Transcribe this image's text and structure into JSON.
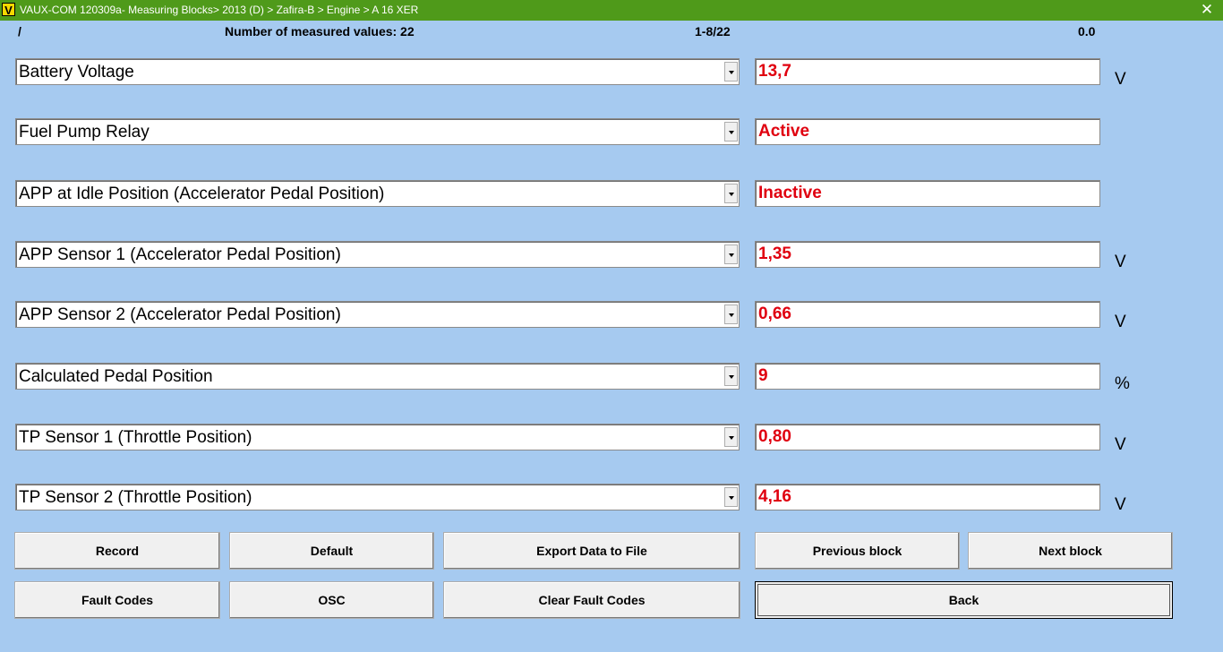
{
  "window": {
    "app_icon": "V",
    "title": "VAUX-COM 120309a- Measuring Blocks> 2013 (D) > Zafira-B > Engine > A 16 XER",
    "close": "✕"
  },
  "header": {
    "slash": "/",
    "measured_values": "Number of measured values: 22",
    "range": "1-8/22",
    "timer": "0.0"
  },
  "rows": [
    {
      "label": "Battery Voltage",
      "value": "13,7",
      "unit": "V"
    },
    {
      "label": "Fuel Pump Relay",
      "value": "Active",
      "unit": ""
    },
    {
      "label": "APP at Idle Position (Accelerator Pedal Position)",
      "value": "Inactive",
      "unit": ""
    },
    {
      "label": "APP Sensor 1 (Accelerator Pedal Position)",
      "value": "1,35",
      "unit": "V"
    },
    {
      "label": "APP Sensor 2 (Accelerator Pedal Position)",
      "value": "0,66",
      "unit": "V"
    },
    {
      "label": "Calculated Pedal Position",
      "value": "9",
      "unit": "%"
    },
    {
      "label": "TP Sensor 1 (Throttle Position)",
      "value": "0,80",
      "unit": "V"
    },
    {
      "label": "TP Sensor 2 (Throttle Position)",
      "value": "4,16",
      "unit": "V"
    }
  ],
  "buttons": {
    "record": "Record",
    "default": "Default",
    "export": "Export Data to File",
    "previous_block": "Previous block",
    "next_block": "Next block",
    "fault_codes": "Fault Codes",
    "osc": "OSC",
    "clear_fault_codes": "Clear Fault Codes",
    "back": "Back"
  },
  "colors": {
    "background": "#a6caf0",
    "titlebar": "#4f9a1a",
    "value_text": "#e0000f"
  }
}
